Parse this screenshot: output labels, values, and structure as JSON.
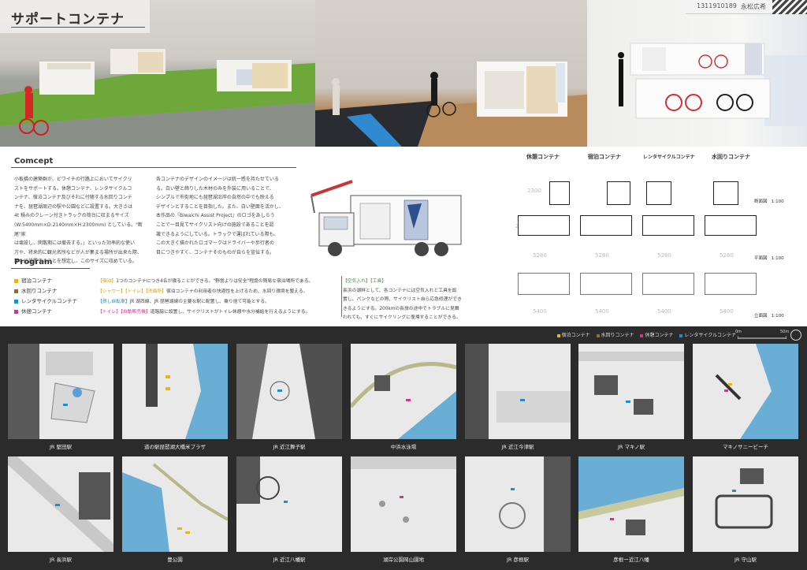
{
  "header": {
    "title": "サポートコンテナ",
    "author_id": "1311910189",
    "author_name": "永松広希"
  },
  "concept": {
    "heading": "Comcept",
    "col1": [
      "小板橋の建築群が、ビワイチの行路上においてサイクリ",
      "ストをサポートする。休憩コンテナ、レンタサイクルコ",
      "ンテナ、宿泊コンテナ及びそれに付随する水回りコンテ",
      "ナを、琵琶湖周辺の駅や公園などに設置する。大きさは",
      "4t 積みのクレーン付きトラックの荷台に収まるサイズ",
      "(W:5400mm×D:2140mm×H:2300mm) としている。\"断尾\"家",
      "は壊設し、閑散期には撤去する。」といった効率的な使い",
      "方や、将来的に観光名所などが人が集まる場所が出来た際、",
      "新たに設置することを想定し、このサイズに収めている。"
    ],
    "col2": [
      "各コンテナのデザインのイメージは統一感を持たせている",
      "る。白い壁と飾りした木材のみを外装に用いることで、",
      "シンプルで市街地にも琵琶湖沿岸の自然の中でも映える",
      "デザインとすることを目指した。また、白い壁面を活かし、",
      "本作品の『Biwaichi Assist Project』のロゴをあしらう",
      "ことで一目見てサイクリスト向けの施設であることを認",
      "識できるようにしている。トラックで運ばれている際も、",
      "この大きく描かれたロゴマークはドライバーや歩行者の",
      "目につきやすく、コンテナそのものが自らを宣伝する。"
    ]
  },
  "program": {
    "heading": "Program",
    "legend": [
      {
        "label": "宿泊コンテナ",
        "color": "#e6b422"
      },
      {
        "label": "水回りコンテナ",
        "color": "#8c6d3f"
      },
      {
        "label": "レンタサイクルコンテナ",
        "color": "#1e90c8"
      },
      {
        "label": "休憩コンテナ",
        "color": "#d6338a"
      }
    ],
    "lines": [
      {
        "tag": "【宿泊】",
        "text": "1つのコンテナにつき4名が寝ることができる。\"野営よりは安全\"程度の簡易な宿泊場所である。"
      },
      {
        "tag": "【シャワー】【トイレ】【洗面所】",
        "text": "宿泊コンテナの利用者の快適性を上げるため、水回り環境を整える。"
      },
      {
        "tag": "【貸し自転車】",
        "text": "JR 湖西線、JR 琵琶湖線の主要な駅に配置し、乗り捨て可能とする。"
      },
      {
        "tag": "【トイレ】【自動販売機】",
        "text": "道路脇に設置し、サイクリストがトイレ休憩や水分補給を行えるようにする。"
      }
    ],
    "notes": [
      "【空気入れ】【工具】",
      "長浜の湖畔として、各コンテナには空気入れと工具を設",
      "置し、パンクなどの際、サイクリスト自ら応急修理ができ",
      "きるようにする。200kmの長旅の途中でトラブルに見舞",
      "われても、すぐにサイクリングに復帰することができる。"
    ]
  },
  "drawings": {
    "containers": [
      "休憩コンテナ",
      "宿泊コンテナ",
      "レンタサイクルコンテナ",
      "水回りコンテナ"
    ],
    "section_label": "断面図",
    "plan_label": "平面図",
    "elevation_label": "立面図",
    "scale": "1:100",
    "height_dim": "2300",
    "width_dim": "5280",
    "length_dim": "5400",
    "depth_dim": "2020"
  },
  "maps": {
    "legend": [
      {
        "label": "宿泊コンテナ",
        "color": "#e6b422"
      },
      {
        "label": "水回りコンテナ",
        "color": "#8c6d3f"
      },
      {
        "label": "休憩コンテナ",
        "color": "#d6338a"
      },
      {
        "label": "レンタサイクルコンテナ",
        "color": "#1e90c8"
      }
    ],
    "scale_start": "0m",
    "scale_end": "50m",
    "row1": [
      "JR 堅田駅",
      "道の駅琵琶湖大橋米プラザ",
      "JR 近江舞子駅",
      "中浜水泳場",
      "JR 近江今津駅",
      "JR マキノ駅",
      "マキノサニービーチ"
    ],
    "row2": [
      "JR 長浜駅",
      "豊公園",
      "JR 近江八幡駅",
      "湖岸公園岡山園地",
      "JR 彦根駅",
      "彦根ー近江八幡",
      "JR 守山駅"
    ]
  }
}
